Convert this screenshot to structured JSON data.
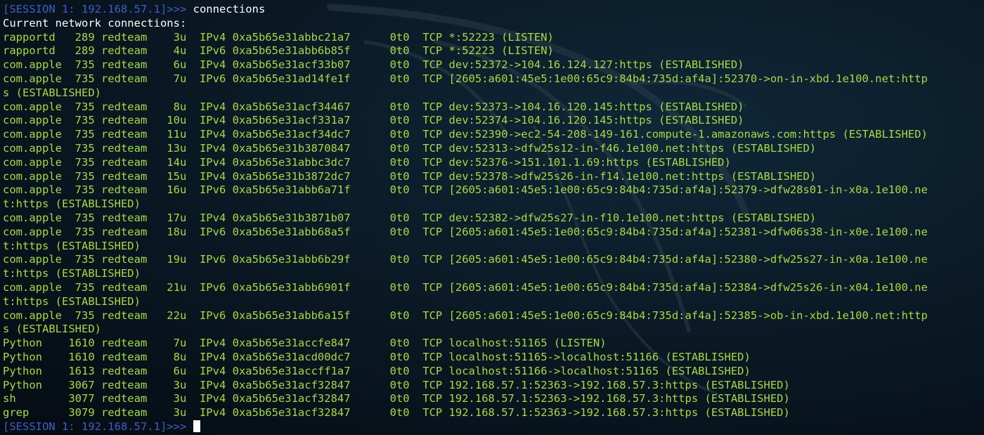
{
  "terminal": {
    "prompt": "[SESSION 1: 192.168.57.1]>>> ",
    "command": "connections",
    "header": "Current network connections:",
    "rows": [
      "rapportd   289 redteam    3u  IPv4 0xa5b65e31abbc21a7      0t0  TCP *:52223 (LISTEN)",
      "rapportd   289 redteam    4u  IPv6 0xa5b65e31abb6b85f      0t0  TCP *:52223 (LISTEN)",
      "com.apple  735 redteam    6u  IPv4 0xa5b65e31acf33b07      0t0  TCP dev:52372->104.16.124.127:https (ESTABLISHED)",
      "com.apple  735 redteam    7u  IPv6 0xa5b65e31ad14fe1f      0t0  TCP [2605:a601:45e5:1e00:65c9:84b4:735d:af4a]:52370->on-in-xbd.1e100.net:http",
      "s (ESTABLISHED)",
      "com.apple  735 redteam    8u  IPv4 0xa5b65e31acf34467      0t0  TCP dev:52373->104.16.120.145:https (ESTABLISHED)",
      "com.apple  735 redteam   10u  IPv4 0xa5b65e31acf331a7      0t0  TCP dev:52374->104.16.120.145:https (ESTABLISHED)",
      "com.apple  735 redteam   11u  IPv4 0xa5b65e31acf34dc7      0t0  TCP dev:52390->ec2-54-208-149-161.compute-1.amazonaws.com:https (ESTABLISHED)",
      "com.apple  735 redteam   13u  IPv4 0xa5b65e31b3870847      0t0  TCP dev:52313->dfw25s12-in-f46.1e100.net:https (ESTABLISHED)",
      "com.apple  735 redteam   14u  IPv4 0xa5b65e31abbc3dc7      0t0  TCP dev:52376->151.101.1.69:https (ESTABLISHED)",
      "com.apple  735 redteam   15u  IPv4 0xa5b65e31b3872dc7      0t0  TCP dev:52378->dfw25s26-in-f14.1e100.net:https (ESTABLISHED)",
      "com.apple  735 redteam   16u  IPv6 0xa5b65e31abb6a71f      0t0  TCP [2605:a601:45e5:1e00:65c9:84b4:735d:af4a]:52379->dfw28s01-in-x0a.1e100.ne",
      "t:https (ESTABLISHED)",
      "com.apple  735 redteam   17u  IPv4 0xa5b65e31b3871b07      0t0  TCP dev:52382->dfw25s27-in-f10.1e100.net:https (ESTABLISHED)",
      "com.apple  735 redteam   18u  IPv6 0xa5b65e31abb68a5f      0t0  TCP [2605:a601:45e5:1e00:65c9:84b4:735d:af4a]:52381->dfw06s38-in-x0e.1e100.ne",
      "t:https (ESTABLISHED)",
      "com.apple  735 redteam   19u  IPv6 0xa5b65e31abb6b29f      0t0  TCP [2605:a601:45e5:1e00:65c9:84b4:735d:af4a]:52380->dfw25s27-in-x0a.1e100.ne",
      "t:https (ESTABLISHED)",
      "com.apple  735 redteam   21u  IPv6 0xa5b65e31abb6901f      0t0  TCP [2605:a601:45e5:1e00:65c9:84b4:735d:af4a]:52384->dfw25s26-in-x04.1e100.ne",
      "t:https (ESTABLISHED)",
      "com.apple  735 redteam   22u  IPv6 0xa5b65e31abb6a15f      0t0  TCP [2605:a601:45e5:1e00:65c9:84b4:735d:af4a]:52385->ob-in-xbd.1e100.net:http",
      "s (ESTABLISHED)",
      "Python    1610 redteam    7u  IPv4 0xa5b65e31accfe847      0t0  TCP localhost:51165 (LISTEN)",
      "Python    1610 redteam    8u  IPv4 0xa5b65e31acd00dc7      0t0  TCP localhost:51165->localhost:51166 (ESTABLISHED)",
      "Python    1613 redteam    6u  IPv4 0xa5b65e31accff1a7      0t0  TCP localhost:51166->localhost:51165 (ESTABLISHED)",
      "Python    3067 redteam    3u  IPv4 0xa5b65e31acf32847      0t0  TCP 192.168.57.1:52363->192.168.57.3:https (ESTABLISHED)",
      "sh        3077 redteam    3u  IPv4 0xa5b65e31acf32847      0t0  TCP 192.168.57.1:52363->192.168.57.3:https (ESTABLISHED)",
      "grep      3079 redteam    3u  IPv4 0xa5b65e31acf32847      0t0  TCP 192.168.57.1:52363->192.168.57.3:https (ESTABLISHED)"
    ],
    "final_prompt": "[SESSION 1: 192.168.57.1]>>> "
  },
  "colors": {
    "background": "#0b1a26",
    "output_text": "#a5db40",
    "prompt_text": "#3c5fc8",
    "command_text": "#ffffff",
    "cursor": "#ffffff"
  }
}
